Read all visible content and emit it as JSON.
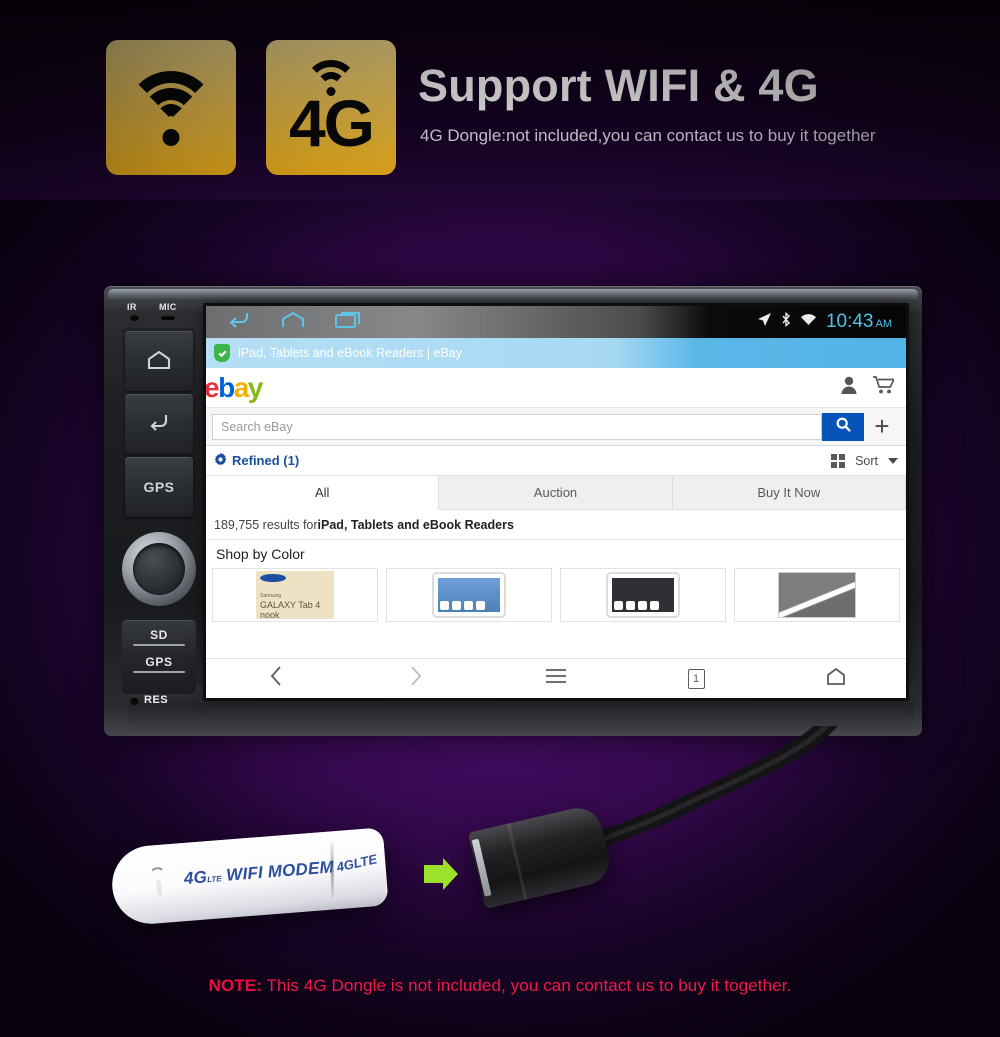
{
  "header": {
    "title": "Support WIFI & 4G",
    "subtitle": "4G Dongle:not included,you can contact us to buy it together",
    "tile1_icon": "wifi-icon",
    "tile2_label": "4G",
    "tile2_icon": "wifi-icon",
    "tile_gradient_top": "#fde391",
    "tile_gradient_bottom": "#f8b61a"
  },
  "stereo": {
    "io_labels": {
      "ir": "IR",
      "mic": "MIC"
    },
    "buttons": [
      {
        "name": "home",
        "label": "",
        "icon": "home-icon"
      },
      {
        "name": "back",
        "label": "",
        "icon": "back-arrow-icon"
      },
      {
        "name": "gps",
        "label": "GPS",
        "icon": ""
      }
    ],
    "knob": "volume-knob",
    "slots": [
      {
        "label": "SD"
      },
      {
        "label": "GPS"
      }
    ],
    "reset": {
      "label": "RES",
      "icon": "reset-hole-icon"
    }
  },
  "screen": {
    "statusbar": {
      "nav": [
        "back-icon",
        "home-icon",
        "recents-icon"
      ],
      "icons": [
        "location-arrow-icon",
        "bluetooth-icon",
        "wifi-icon"
      ],
      "time": "10:43",
      "ampm": "AM",
      "clock_color": "#4fc3e8"
    },
    "browser_tab": {
      "title": "iPad, Tablets and eBook Readers | eBay",
      "security_icon": "shield-check-icon"
    },
    "ebay": {
      "logo": {
        "e": "e",
        "b": "b",
        "a": "a",
        "y": "y"
      },
      "header_icons": [
        "user-icon",
        "cart-icon"
      ],
      "search_placeholder": "Search eBay",
      "search_value": "",
      "search_icon": "magnifier-icon",
      "add_icon": "plus-icon",
      "refined_label": "Refined (1)",
      "refined_icon": "gear-icon",
      "grid_icon": "grid-view-icon",
      "sort_label": "Sort",
      "sort_icon": "chevron-down-icon",
      "tabs": [
        {
          "label": "All",
          "active": true
        },
        {
          "label": "Auction",
          "active": false
        },
        {
          "label": "Buy It Now",
          "active": false
        }
      ],
      "result_count": "189,755 results for ",
      "result_query": "iPad, Tablets and eBook Readers",
      "shop_by_color": "Shop by Color",
      "thumbnails": [
        {
          "name": "samsung-galaxy-tab-box",
          "brand": "Samsung",
          "line1": "Samsung",
          "line2": "GALAXY Tab 4 nook"
        },
        {
          "name": "ipad-light-thumb"
        },
        {
          "name": "ipad-dark-thumb"
        },
        {
          "name": "grey-graphic-thumb"
        }
      ]
    },
    "browser_toolbar": [
      {
        "name": "back",
        "icon": "chevron-left-icon",
        "dim": false
      },
      {
        "name": "forward",
        "icon": "chevron-right-icon",
        "dim": true
      },
      {
        "name": "menu",
        "icon": "hamburger-icon",
        "dim": false
      },
      {
        "name": "tabs",
        "icon": "tab-count-icon",
        "label": "1",
        "dim": false
      },
      {
        "name": "home",
        "icon": "home-icon",
        "dim": false
      }
    ]
  },
  "dongle": {
    "label_main": "4G",
    "label_lte": "LTE",
    "label_rest": " WIFI MODEM",
    "label_end": "4G",
    "end_lte": "LTE"
  },
  "accessory": {
    "usb_connector": "usb-female-connector",
    "arrow": "green-arrow-right-icon",
    "arrow_color": "#9de22a"
  },
  "note": {
    "prefix": "NOTE:",
    "text": " This 4G Dongle is not included, you can contact us to buy it together.",
    "color": "#f0194a"
  }
}
